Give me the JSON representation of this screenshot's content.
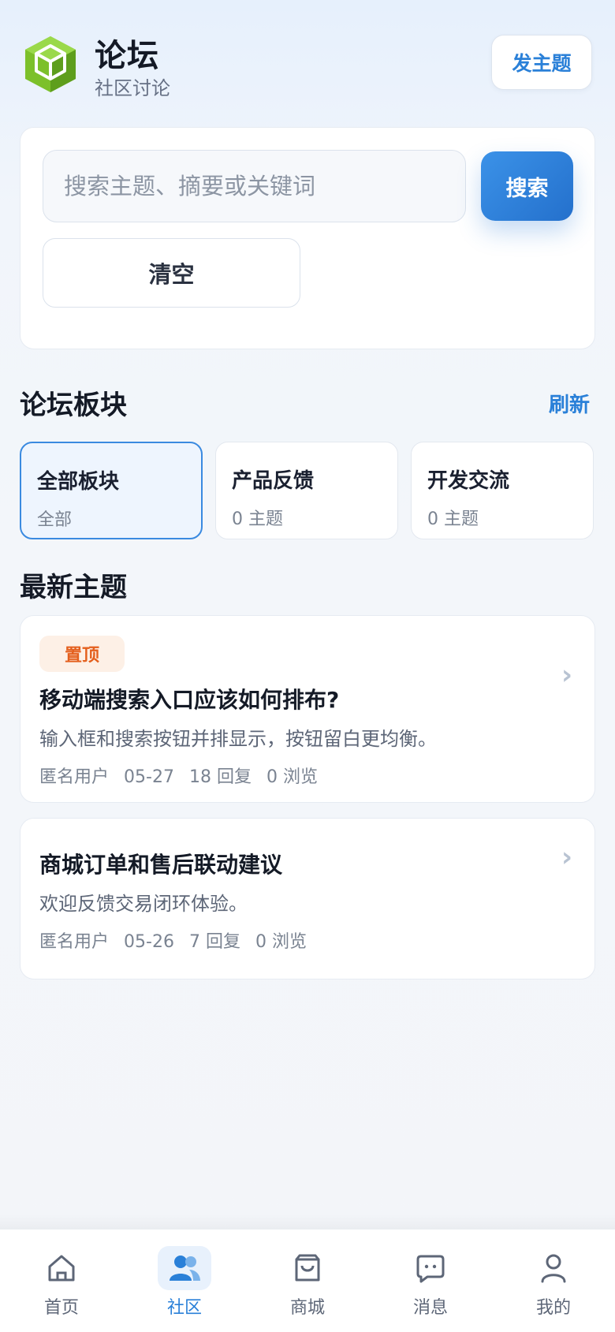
{
  "header": {
    "title": "论坛",
    "subtitle": "社区讨论",
    "post_button": "发主题"
  },
  "search": {
    "placeholder": "搜索主题、摘要或关键词",
    "value": "",
    "search_button": "搜索",
    "clear_button": "清空"
  },
  "boards_section": {
    "title": "论坛板块",
    "refresh": "刷新",
    "boards": [
      {
        "name": "全部板块",
        "count": "全部",
        "active": true
      },
      {
        "name": "产品反馈",
        "count": "0 主题",
        "active": false
      },
      {
        "name": "开发交流",
        "count": "0 主题",
        "active": false
      }
    ]
  },
  "topics_section": {
    "title": "最新主题",
    "topics": [
      {
        "badge": "置顶",
        "title": "移动端搜索入口应该如何排布?",
        "summary": "输入框和搜索按钮并排显示，按钮留白更均衡。",
        "author": "匿名用户",
        "date": "05-27",
        "replies": "18 回复",
        "views": "0 浏览"
      },
      {
        "badge": "",
        "title": "商城订单和售后联动建议",
        "summary": "欢迎反馈交易闭环体验。",
        "author": "匿名用户",
        "date": "05-26",
        "replies": "7 回复",
        "views": "0 浏览"
      }
    ]
  },
  "bottom_nav": {
    "items": [
      {
        "label": "首页",
        "icon": "home-icon",
        "active": false
      },
      {
        "label": "社区",
        "icon": "community-icon",
        "active": true
      },
      {
        "label": "商城",
        "icon": "shop-bag-icon",
        "active": false
      },
      {
        "label": "消息",
        "icon": "message-icon",
        "active": false
      },
      {
        "label": "我的",
        "icon": "profile-icon",
        "active": false
      }
    ]
  },
  "colors": {
    "accent": "#2a80d8",
    "logo_green": "#7cc02a",
    "pin_badge_text": "#e4601e",
    "pin_badge_bg": "#fdf0e6"
  }
}
